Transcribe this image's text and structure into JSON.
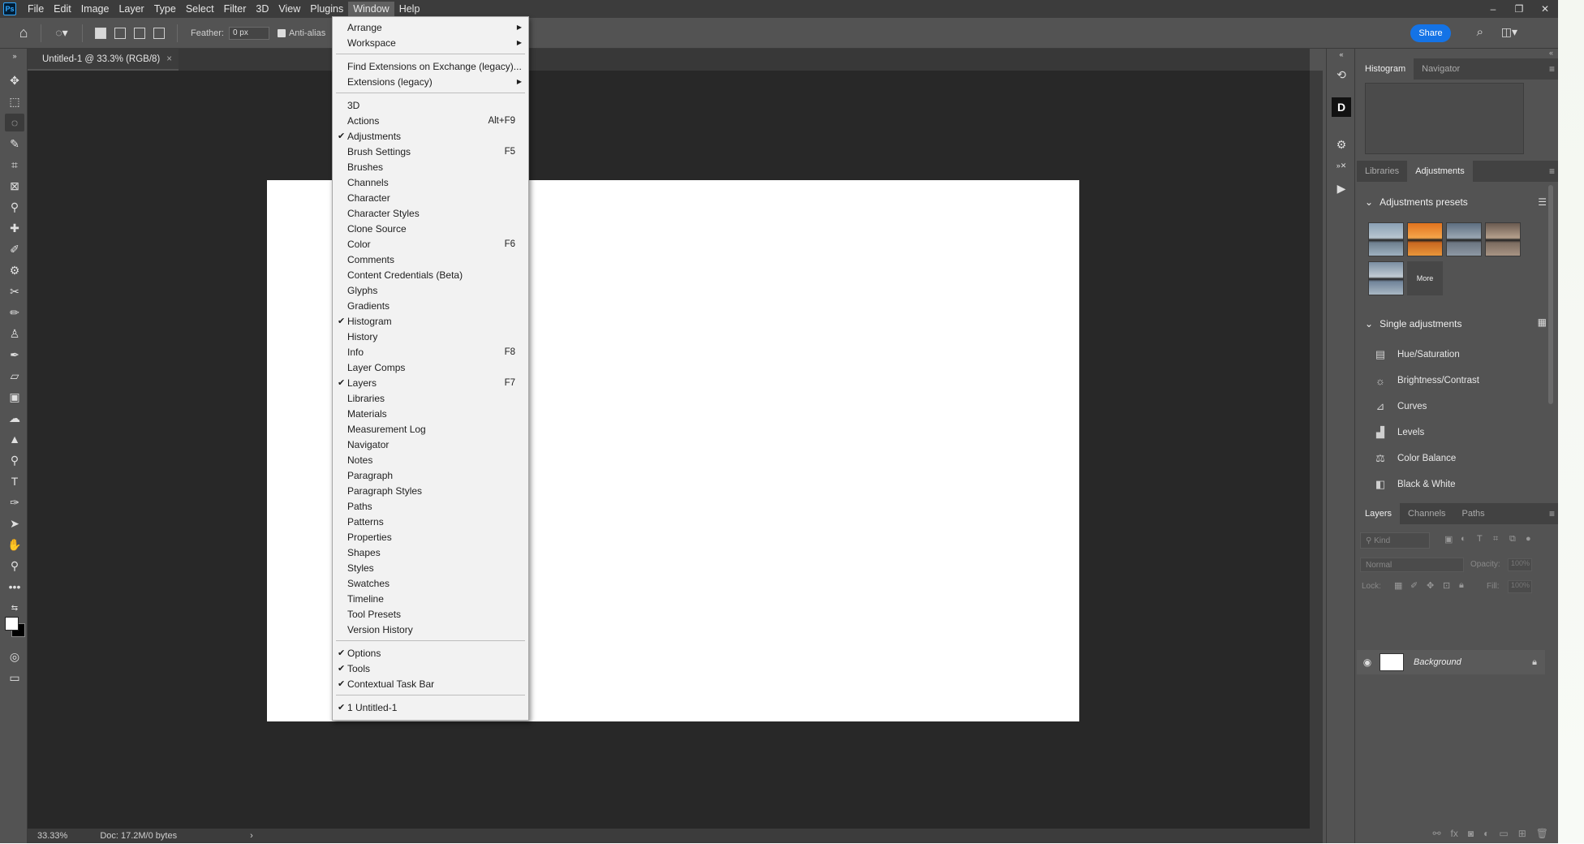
{
  "app": {
    "logo": "Ps",
    "window_controls": [
      "–",
      "❐",
      "✕"
    ]
  },
  "menubar": {
    "items": [
      "File",
      "Edit",
      "Image",
      "Layer",
      "Type",
      "Select",
      "Filter",
      "3D",
      "View",
      "Plugins",
      "Window",
      "Help"
    ],
    "active": "Window"
  },
  "options": {
    "feather_label": "Feather:",
    "feather_value": "0 px",
    "antialias_label": "Anti-alias",
    "antialias_checked": true,
    "share_label": "Share"
  },
  "document": {
    "tab_title": "Untitled-1 @ 33.3% (RGB/8)",
    "zoom": "33.33%",
    "doc_info": "Doc: 17.2M/0 bytes"
  },
  "window_menu": {
    "groups": [
      [
        {
          "label": "Arrange",
          "submenu": true
        },
        {
          "label": "Workspace",
          "submenu": true
        }
      ],
      [
        {
          "label": "Find Extensions on Exchange (legacy)..."
        },
        {
          "label": "Extensions (legacy)",
          "submenu": true
        }
      ],
      [
        {
          "label": "3D"
        },
        {
          "label": "Actions",
          "shortcut": "Alt+F9"
        },
        {
          "label": "Adjustments",
          "checked": true
        },
        {
          "label": "Brush Settings",
          "shortcut": "F5"
        },
        {
          "label": "Brushes"
        },
        {
          "label": "Channels"
        },
        {
          "label": "Character"
        },
        {
          "label": "Character Styles"
        },
        {
          "label": "Clone Source"
        },
        {
          "label": "Color",
          "shortcut": "F6"
        },
        {
          "label": "Comments"
        },
        {
          "label": "Content Credentials (Beta)"
        },
        {
          "label": "Glyphs"
        },
        {
          "label": "Gradients"
        },
        {
          "label": "Histogram",
          "checked": true
        },
        {
          "label": "History"
        },
        {
          "label": "Info",
          "shortcut": "F8"
        },
        {
          "label": "Layer Comps"
        },
        {
          "label": "Layers",
          "checked": true,
          "shortcut": "F7"
        },
        {
          "label": "Libraries"
        },
        {
          "label": "Materials"
        },
        {
          "label": "Measurement Log"
        },
        {
          "label": "Navigator"
        },
        {
          "label": "Notes"
        },
        {
          "label": "Paragraph"
        },
        {
          "label": "Paragraph Styles"
        },
        {
          "label": "Paths"
        },
        {
          "label": "Patterns"
        },
        {
          "label": "Properties"
        },
        {
          "label": "Shapes"
        },
        {
          "label": "Styles"
        },
        {
          "label": "Swatches"
        },
        {
          "label": "Timeline"
        },
        {
          "label": "Tool Presets"
        },
        {
          "label": "Version History"
        }
      ],
      [
        {
          "label": "Options",
          "checked": true
        },
        {
          "label": "Tools",
          "checked": true
        },
        {
          "label": "Contextual Task Bar",
          "checked": true
        }
      ],
      [
        {
          "label": "1 Untitled-1",
          "checked": true
        }
      ]
    ]
  },
  "panels": {
    "top_tabs": [
      "Histogram",
      "Navigator"
    ],
    "top_active": "Histogram",
    "mid_tabs": [
      "Libraries",
      "Adjustments"
    ],
    "mid_active": "Adjustments",
    "presets_heading": "Adjustments presets",
    "presets_more": "More",
    "single_heading": "Single adjustments",
    "adjustments": [
      {
        "label": "Hue/Saturation",
        "icon": "hue-saturation-icon",
        "glyph": "▤"
      },
      {
        "label": "Brightness/Contrast",
        "icon": "brightness-contrast-icon",
        "glyph": "☼"
      },
      {
        "label": "Curves",
        "icon": "curves-icon",
        "glyph": "⊿"
      },
      {
        "label": "Levels",
        "icon": "levels-icon",
        "glyph": "▟"
      },
      {
        "label": "Color Balance",
        "icon": "color-balance-icon",
        "glyph": "⚖"
      },
      {
        "label": "Black & White",
        "icon": "black-white-icon",
        "glyph": "◧"
      }
    ],
    "layer_tabs": [
      "Layers",
      "Channels",
      "Paths"
    ],
    "layer_active": "Layers",
    "filter_placeholder": "Kind",
    "blend_mode": "Normal",
    "opacity_label": "Opacity:",
    "opacity_value": "100%",
    "lock_label": "Lock:",
    "fill_label": "Fill:",
    "fill_value": "100%",
    "layers": [
      {
        "name": "Background",
        "locked": true,
        "visible": true
      }
    ]
  }
}
